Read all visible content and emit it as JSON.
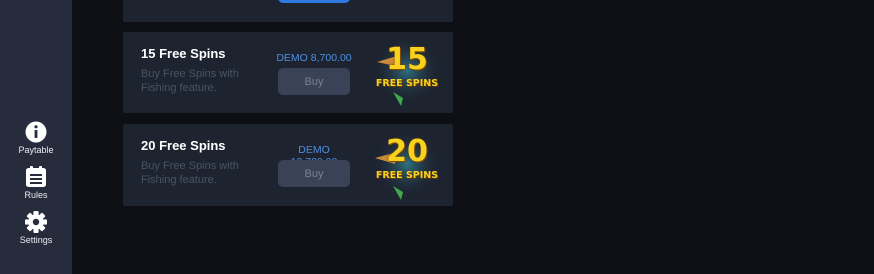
{
  "sidebar": {
    "items": [
      {
        "label": "Paytable",
        "icon": "info-icon"
      },
      {
        "label": "Rules",
        "icon": "rules-list-icon"
      },
      {
        "label": "Settings",
        "icon": "gear-icon"
      }
    ]
  },
  "offers": [
    {
      "title": "15 Free Spins",
      "description": "Buy Free Spins with Fishing feature.",
      "price": "DEMO 8,700.00",
      "buy_label": "Buy",
      "emblem_number": "15",
      "emblem_text": "FREE SPINS"
    },
    {
      "title": "20 Free Spins",
      "description": "Buy Free Spins with Fishing feature.",
      "price": "DEMO 13,700.00",
      "buy_label": "Buy",
      "emblem_number": "20",
      "emblem_text": "FREE SPINS"
    }
  ],
  "colors": {
    "sidebar_bg": "#262c3b",
    "card_bg": "#1e2330",
    "price": "#4c8fe0",
    "buy_button_bg": "#3a4257",
    "emblem_yellow": "#f7d21e"
  }
}
